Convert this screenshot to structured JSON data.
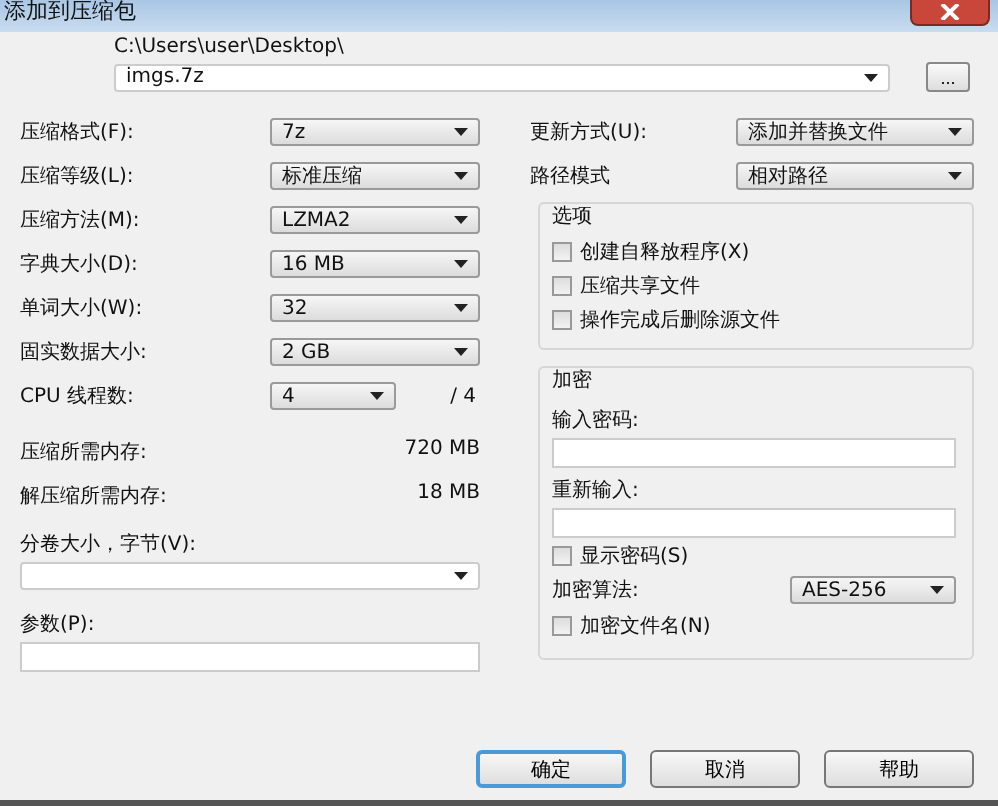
{
  "window": {
    "title": "添加到压缩包"
  },
  "archive": {
    "folder": "C:\\Users\\user\\Desktop\\",
    "name": "imgs.7z",
    "browse_button": "..."
  },
  "settings": [
    {
      "label": "压缩格式(F):",
      "value": "7z"
    },
    {
      "label": "压缩等级(L):",
      "value": "标准压缩"
    },
    {
      "label": "压缩方法(M):",
      "value": "LZMA2"
    },
    {
      "label": "字典大小(D):",
      "value": "16 MB"
    },
    {
      "label": "单词大小(W):",
      "value": "32"
    },
    {
      "label": "固实数据大小:",
      "value": "2 GB"
    }
  ],
  "cpu_threads": {
    "label": "CPU 线程数:",
    "value": "4",
    "max": "/ 4"
  },
  "memory": [
    {
      "label": "压缩所需内存:",
      "value": "720 MB"
    },
    {
      "label": "解压缩所需内存:",
      "value": "18 MB"
    }
  ],
  "volume": {
    "label": "分卷大小，字节(V):"
  },
  "parameters": {
    "label": "参数(P):"
  },
  "right_settings": [
    {
      "label": "更新方式(U):",
      "value": "添加并替换文件"
    },
    {
      "label": "路径模式",
      "value": "相对路径"
    }
  ],
  "options": {
    "title": "选项",
    "items": [
      {
        "label": "创建自释放程序(X)",
        "checked": false
      },
      {
        "label": "压缩共享文件",
        "checked": false
      },
      {
        "label": "操作完成后删除源文件",
        "checked": false
      }
    ]
  },
  "encryption": {
    "title": "加密",
    "password_label": "输入密码:",
    "reenter_label": "重新输入:",
    "show_password": {
      "label": "显示密码(S)",
      "checked": false
    },
    "method_label": "加密算法:",
    "method": "AES-256",
    "encrypt_names": {
      "label": "加密文件名(N)",
      "checked": false
    }
  },
  "buttons": [
    {
      "label": "确定",
      "default": true
    },
    {
      "label": "取消",
      "default": false
    },
    {
      "label": "帮助",
      "default": false
    }
  ]
}
